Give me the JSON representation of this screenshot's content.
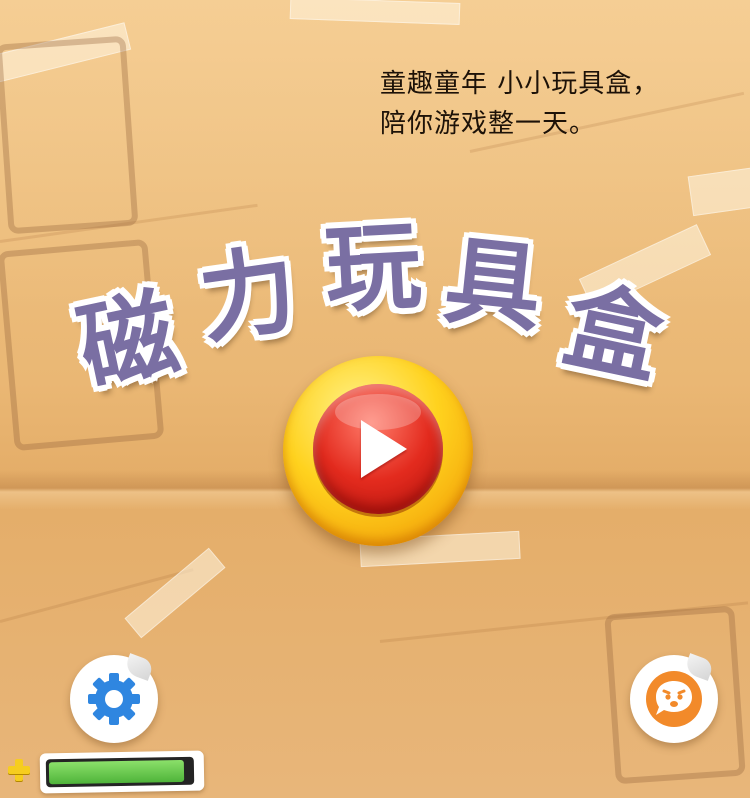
{
  "header": {
    "tagline_line1": "童趣童年 小小玩具盒，",
    "tagline_line2": "陪你游戏整一天。"
  },
  "logo": {
    "chars": [
      "磁",
      "力",
      "玩",
      "具",
      "盒"
    ]
  },
  "play_button": {
    "icon": "play-icon"
  },
  "footer": {
    "settings_icon": "gear-icon",
    "chat_icon": "chat-bubble-icon",
    "energy": {
      "icon": "plus-icon",
      "level": 0.95
    }
  },
  "colors": {
    "title": "#7a6fa3",
    "play_ring": "#ffd21e",
    "play_core": "#e32b1e",
    "settings_blue": "#2f86e0",
    "chat_orange": "#f28a2a",
    "battery_green": "#5fc046"
  }
}
